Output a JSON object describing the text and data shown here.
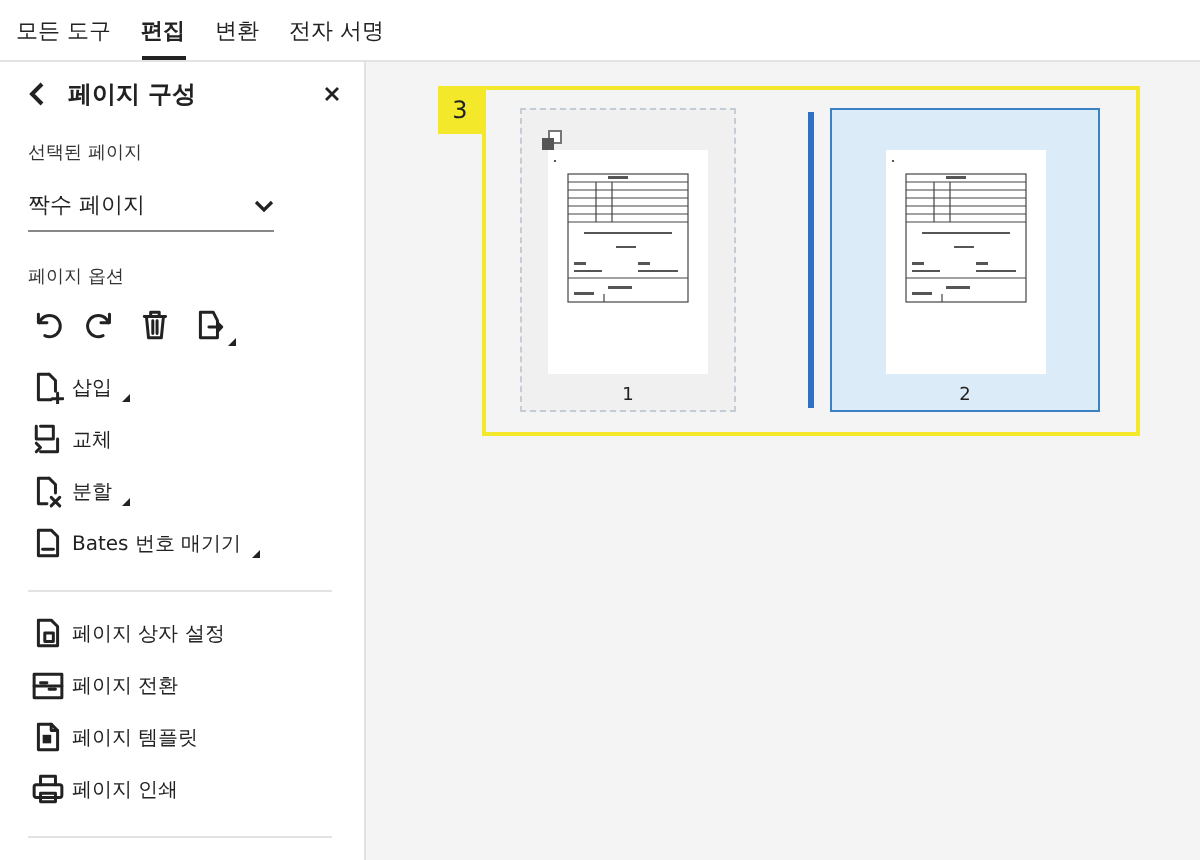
{
  "tabs": [
    {
      "label": "모든 도구",
      "selected": false
    },
    {
      "label": "편집",
      "selected": true
    },
    {
      "label": "변환",
      "selected": false
    },
    {
      "label": "전자 서명",
      "selected": false
    }
  ],
  "panel": {
    "title": "페이지 구성",
    "selected_pages_label": "선택된 페이지",
    "page_select": {
      "value": "짝수 페이지"
    },
    "options_label": "페이지 옵션",
    "tools": [
      {
        "kind": "rotate-left",
        "submenu": false
      },
      {
        "kind": "rotate-right",
        "submenu": false
      },
      {
        "kind": "delete",
        "submenu": false
      },
      {
        "kind": "extract",
        "submenu": true
      }
    ],
    "actions": [
      {
        "kind": "insert",
        "label": "삽입",
        "submenu": true
      },
      {
        "kind": "replace",
        "label": "교체",
        "submenu": false
      },
      {
        "kind": "split",
        "label": "분할",
        "submenu": true
      },
      {
        "kind": "bates",
        "label": "Bates 번호 매기기",
        "submenu": true
      }
    ],
    "more_actions": [
      {
        "kind": "page-box",
        "label": "페이지 상자 설정",
        "submenu": false
      },
      {
        "kind": "transition",
        "label": "페이지 전환",
        "submenu": false
      },
      {
        "kind": "template",
        "label": "페이지 템플릿",
        "submenu": false
      },
      {
        "kind": "print",
        "label": "페이지 인쇄",
        "submenu": false
      }
    ]
  },
  "canvas": {
    "badge": "3",
    "pages": [
      {
        "number": "1",
        "selected": false,
        "hovered": true,
        "insert_before": false
      },
      {
        "number": "2",
        "selected": true,
        "hovered": false,
        "insert_before": true
      }
    ]
  }
}
